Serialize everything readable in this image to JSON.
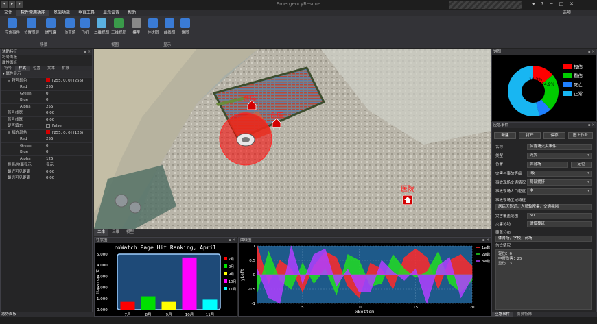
{
  "app": {
    "title": "EmergencyRescue",
    "user": "选项"
  },
  "quick_access": [
    "◂",
    "▸",
    "▾"
  ],
  "window_controls": [
    "▾",
    "?",
    "─",
    "□",
    "✕"
  ],
  "menu": [
    "文件",
    "软件常用功能",
    "基础功能",
    "垂直工具",
    "显示设置",
    "帮助"
  ],
  "ribbon": {
    "buttons": [
      {
        "label": "应急事件",
        "color": "#3a7bd5"
      },
      {
        "label": "位置图层",
        "color": "#3a7bd5"
      },
      {
        "label": "燃气罐",
        "color": "#3a7bd5"
      },
      {
        "label": "体育场",
        "color": "#3a7bd5"
      },
      {
        "label": "飞机",
        "color": "#3a7bd5"
      },
      {
        "label": "二维视图",
        "color": "#5ab0e0"
      },
      {
        "label": "三维视图",
        "color": "#3a9a4a"
      },
      {
        "label": "模型",
        "color": "#888888"
      },
      {
        "label": "柱状图",
        "color": "#3a7bd5"
      },
      {
        "label": "曲线图",
        "color": "#3a7bd5"
      },
      {
        "label": "饼图",
        "color": "#3a7bd5"
      }
    ],
    "groups": [
      "场景",
      "视图",
      "显示"
    ]
  },
  "left": {
    "panel_title": "辅助特征",
    "sub1": "符号面板",
    "sub2": "属性面板",
    "tabs": [
      "符号",
      "样式",
      "位置",
      "文本",
      "扩展"
    ],
    "props": [
      {
        "k": "属性显示",
        "v": "",
        "lvl": 0,
        "sec": true
      },
      {
        "k": "符号颜色",
        "v": "[255, 0, 0] (255)",
        "lvl": 1,
        "sw": "#d40000"
      },
      {
        "k": "Red",
        "v": "255",
        "lvl": 2
      },
      {
        "k": "Green",
        "v": "0",
        "lvl": 2
      },
      {
        "k": "Blue",
        "v": "0",
        "lvl": 2
      },
      {
        "k": "Alpha",
        "v": "255",
        "lvl": 2
      },
      {
        "k": "符号线宽",
        "v": "0.00",
        "lvl": 1
      },
      {
        "k": "符号线厚",
        "v": "0.00",
        "lvl": 1
      },
      {
        "k": "是否填充",
        "v": "False",
        "lvl": 1,
        "chk": true
      },
      {
        "k": "填充颜色",
        "v": "[255, 0, 0] (125)",
        "lvl": 1,
        "sw": "#d40000"
      },
      {
        "k": "Red",
        "v": "255",
        "lvl": 2
      },
      {
        "k": "Green",
        "v": "0",
        "lvl": 2
      },
      {
        "k": "Blue",
        "v": "0",
        "lvl": 2
      },
      {
        "k": "Alpha",
        "v": "125",
        "lvl": 2
      },
      {
        "k": "投影/地面显示",
        "v": "显示",
        "lvl": 1
      },
      {
        "k": "最近可见距离",
        "v": "0.00",
        "lvl": 1
      },
      {
        "k": "最远可见距离",
        "v": "0.00",
        "lvl": 1
      }
    ],
    "bottom_label": "态势面板"
  },
  "map": {
    "labels": [
      "仓库",
      "仓库",
      "医院"
    ],
    "tabs": [
      "二维",
      "三维",
      "模型"
    ]
  },
  "pie": {
    "title": "饼图",
    "chart_data": {
      "type": "pie",
      "slices": [
        {
          "name": "轻伤",
          "value": 14,
          "color": "#ff0000"
        },
        {
          "name": "重伤",
          "value": 24,
          "color": "#00cc00"
        },
        {
          "name": "死亡",
          "value": 8,
          "color": "#1e7fff"
        },
        {
          "name": "正常",
          "value": 54,
          "color": "#18b6f2"
        }
      ],
      "labels": [
        "14.3%",
        "24.9%"
      ]
    }
  },
  "event": {
    "title": "应急事件",
    "buttons": [
      "新建",
      "打开",
      "保存",
      "图上作业"
    ],
    "fields": [
      {
        "label": "名称",
        "value": "体育场火灾事件",
        "dd": false
      },
      {
        "label": "类型",
        "value": "火灾",
        "dd": true
      },
      {
        "label": "位置",
        "value": "体育场",
        "dd": false,
        "btn": "定位"
      },
      {
        "label": "灾害与事故等级",
        "value": "I级",
        "dd": true
      },
      {
        "label": "事故现场交通情况",
        "value": "局部拥挤",
        "dd": true
      },
      {
        "label": "事故现场人口密度",
        "value": "中",
        "dd": true
      }
    ],
    "feature_label": "事故现场区域特征",
    "feature_value": "居民区附近，人员较密集，交通拥堵",
    "range_label": "灾害覆盖范围",
    "range_value": "50",
    "help_label": "灾害协助",
    "help_value": "缓慢蔓延",
    "affected_label": "覆盖分布",
    "affected_value": "体育场，学校，商场",
    "casualty_label": "伤亡情况",
    "casualty_lines": [
      "轻伤：6",
      "中度伤害：25",
      "重伤：3"
    ],
    "bottom_tabs": [
      "应急事件",
      "伤员特殊"
    ]
  },
  "bar": {
    "panel_title": "柱状图",
    "chart_data": {
      "type": "bar",
      "title": "roWatch Page Hit Ranking, April",
      "categories": [
        "7月",
        "8月",
        "9月",
        "10月",
        "11月"
      ],
      "values": [
        0.7,
        1.2,
        0.7,
        4.7,
        0.9
      ],
      "colors": [
        "#ff0000",
        "#00e000",
        "#ffff00",
        "#ff00ff",
        "#00ffff"
      ],
      "ylabel": "Hits per day (K)",
      "ylim": [
        0,
        5
      ],
      "yticks": [
        "0.000",
        "1.000",
        "2.000",
        "3.000",
        "4.000",
        "5.000"
      ]
    }
  },
  "line": {
    "panel_title": "曲线图",
    "chart_data": {
      "type": "area",
      "x": [
        1,
        2,
        3,
        4,
        5,
        6,
        7,
        8,
        9,
        10,
        11,
        12,
        13,
        14,
        15,
        16,
        17,
        18,
        19,
        20
      ],
      "series": [
        {
          "name": "1w数",
          "color": "#ff2a2a",
          "values": [
            1,
            -0.3,
            0.5,
            0.2,
            -0.6,
            0.3,
            0.8,
            0.6,
            -0.4,
            -0.8,
            0.4,
            0.2,
            -0.5,
            0.6,
            0.9,
            0.6,
            -0.5,
            0.5,
            0.7,
            0.3
          ]
        },
        {
          "name": "2w数",
          "color": "#22dd22",
          "values": [
            -0.6,
            0.8,
            -0.2,
            -0.5,
            0.4,
            -0.3,
            0.2,
            -0.7,
            0.7,
            0.5,
            -0.4,
            -0.3,
            0.7,
            0.2,
            -0.1,
            0.1,
            0.8,
            -0.3,
            -0.6,
            -0.2
          ]
        },
        {
          "name": "3w数",
          "color": "#b040ff",
          "values": [
            0.2,
            -0.8,
            -1,
            1,
            -0.3,
            0.7,
            0.9,
            -0.4,
            0.2,
            -0.6,
            -0.6,
            0.5,
            0.1,
            -0.2,
            0.2,
            -1,
            0.3,
            0.6,
            -0.8,
            -0.1
          ]
        }
      ],
      "xlabel": "xBottom",
      "ylabel": "yLeft",
      "ylim": [
        -1,
        1
      ],
      "xticks": [
        "5",
        "10",
        "15",
        "20"
      ],
      "yticks": [
        "1",
        "0.5",
        "0",
        "-0.5",
        "-1"
      ]
    }
  }
}
